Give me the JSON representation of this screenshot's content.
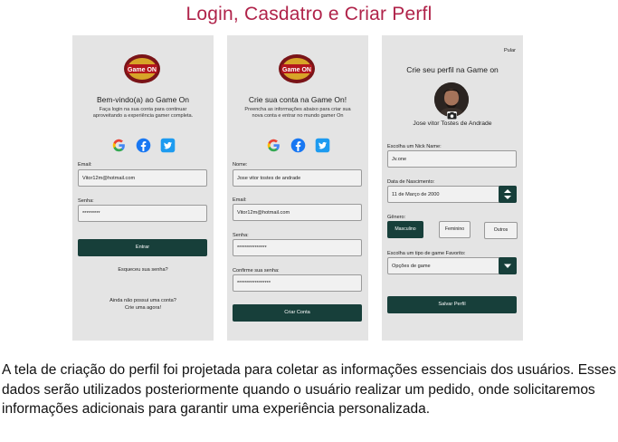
{
  "page_title": "Login, Casdatro e Criar Perfl",
  "logo": {
    "text": "Game ON",
    "icon": "game-on-logo"
  },
  "social_icons": [
    "google-icon",
    "facebook-icon",
    "twitter-icon"
  ],
  "login": {
    "heading": "Bem-vindo(a) ao Game On",
    "subtext": "Faça login na sua conta para continuar aproveitando a experiência gamer completa.",
    "email_label": "Email:",
    "email_value": "Vitor12m@hotmail.com",
    "password_label": "Senha:",
    "password_value": "*********",
    "submit_label": "Entrar",
    "forgot_label": "Esqueceu sua senha?",
    "no_account_label": "Ainda não possui uma conta?",
    "create_label": "Crie uma agora!"
  },
  "register": {
    "heading": "Crie sua conta na Game On!",
    "subtext": "Preencha as informações abaixo para criar sua nova conta e entrar no mundo gamer On",
    "name_label": "Nome:",
    "name_value": "Jose vitor tostes de andrade",
    "email_label": "Email:",
    "email_value": "Vitor12m@hotmail.com",
    "password_label": "Senha:",
    "password_value": "***************",
    "confirm_label": "Confirme sua senha:",
    "confirm_value": "*****************",
    "submit_label": "Criar Conta"
  },
  "profile": {
    "skip_label": "Pular",
    "heading": "Crie seu perfil na Game on",
    "user_name": "Jose vitor Tostes de Andrade",
    "nick_label": "Escolha um Nick Name:",
    "nick_value": "Jv.one",
    "birth_label": "Data de Nascimento:",
    "birth_value": "11 de Março de 2000",
    "gender_label": "Gênero:",
    "gender_options": [
      "Masculino",
      "Feminino",
      "Outros"
    ],
    "gender_selected": "Masculino",
    "game_type_label": "Escolha um tipo de game Favorito:",
    "game_type_value": "Opções de game",
    "submit_label": "Salvar Perfil"
  },
  "caption": "A tela de criação do perfil foi projetada para coletar as informações essenciais dos usuários. Esses dados serão utilizados posteriormente quando o usuário realizar um pedido, onde solicitaremos informações adicionais para garantir uma experiência personalizada.",
  "colors": {
    "accent": "#173f3a",
    "title": "#b0234a",
    "panel": "#e4e4e4"
  }
}
